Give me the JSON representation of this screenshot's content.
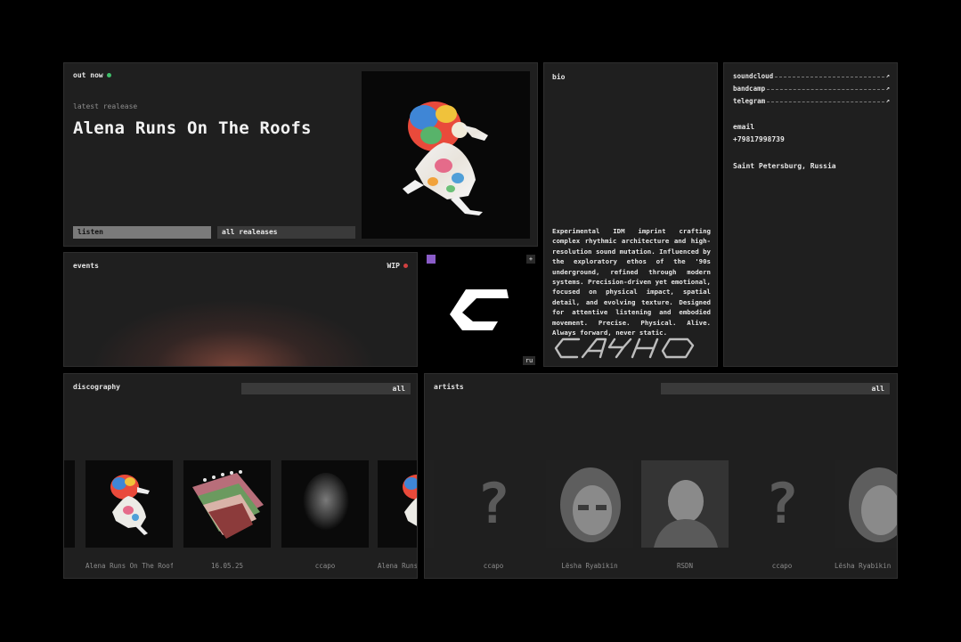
{
  "out_now": {
    "label": "out now",
    "status_color": "#3fbf6a",
    "sub_label": "latest realease",
    "title": "Alena Runs On The Roofs",
    "listen_label": "listen",
    "all_releases_label": "all realeases"
  },
  "bio": {
    "label": "bio",
    "text": "Experimental IDM imprint crafting complex rhythmic architecture and high-resolution sound mutation. Influenced by the exploratory ethos of the '90s underground, refined through modern systems. Precision-driven yet emotional, focused on physical impact, spatial detail, and evolving texture. Designed for attentive listening and embodied movement. Precise. Physical. Alive. Always forward, never static.",
    "logo_text": "CAYHO"
  },
  "links": {
    "items": [
      {
        "label": "soundcloud",
        "arrow": "↗"
      },
      {
        "label": "bandcamp",
        "arrow": "↗"
      },
      {
        "label": "telegram",
        "arrow": "↗"
      }
    ],
    "email_label": "email",
    "phone": "+79817998739",
    "location": "Saint Petersburg, Russia"
  },
  "events": {
    "label": "events",
    "badge": "WIP",
    "badge_color": "#d04040"
  },
  "logo_block": {
    "plus": "+",
    "corner": "ru",
    "accent_color": "#8a5cc8"
  },
  "discography": {
    "label": "discography",
    "all_label": "all",
    "captions": [
      "Alena Runs On The Roofs",
      "16.05.25",
      "ccapo",
      "Alena Runs On The Roofs"
    ]
  },
  "artists": {
    "label": "artists",
    "all_label": "all",
    "captions": [
      "ccapo",
      "Lësha Ryabikin",
      "RSDN",
      "ccapo",
      "Lësha Ryabikin"
    ]
  }
}
